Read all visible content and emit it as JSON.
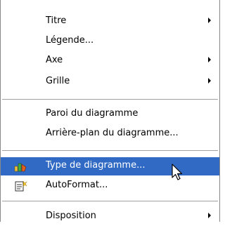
{
  "menu": {
    "items": [
      {
        "name": "Titre",
        "label": "Titre",
        "submenu": true
      },
      {
        "name": "Légende",
        "label": "Légende...",
        "submenu": false
      },
      {
        "name": "Axe",
        "label": "Axe",
        "submenu": true
      },
      {
        "name": "Grille",
        "label": "Grille",
        "submenu": true
      },
      {
        "name": "Paroi",
        "label": "Paroi du diagramme",
        "submenu": false
      },
      {
        "name": "Arriere",
        "label": "Arrière-plan du diagramme...",
        "submenu": false
      },
      {
        "name": "Type",
        "label": "Type de diagramme...",
        "submenu": false,
        "icon": "chart-type-icon",
        "highlighted": true
      },
      {
        "name": "AutoFormat",
        "label": "AutoFormat...",
        "submenu": false,
        "icon": "autoformat-icon"
      },
      {
        "name": "Disposition",
        "label": "Disposition",
        "submenu": true
      }
    ]
  },
  "colors": {
    "highlight": "#316ac5",
    "text": "#000000",
    "highlight_text": "#ffffff"
  },
  "cursor": {
    "icon": "mouse-pointer-icon"
  }
}
